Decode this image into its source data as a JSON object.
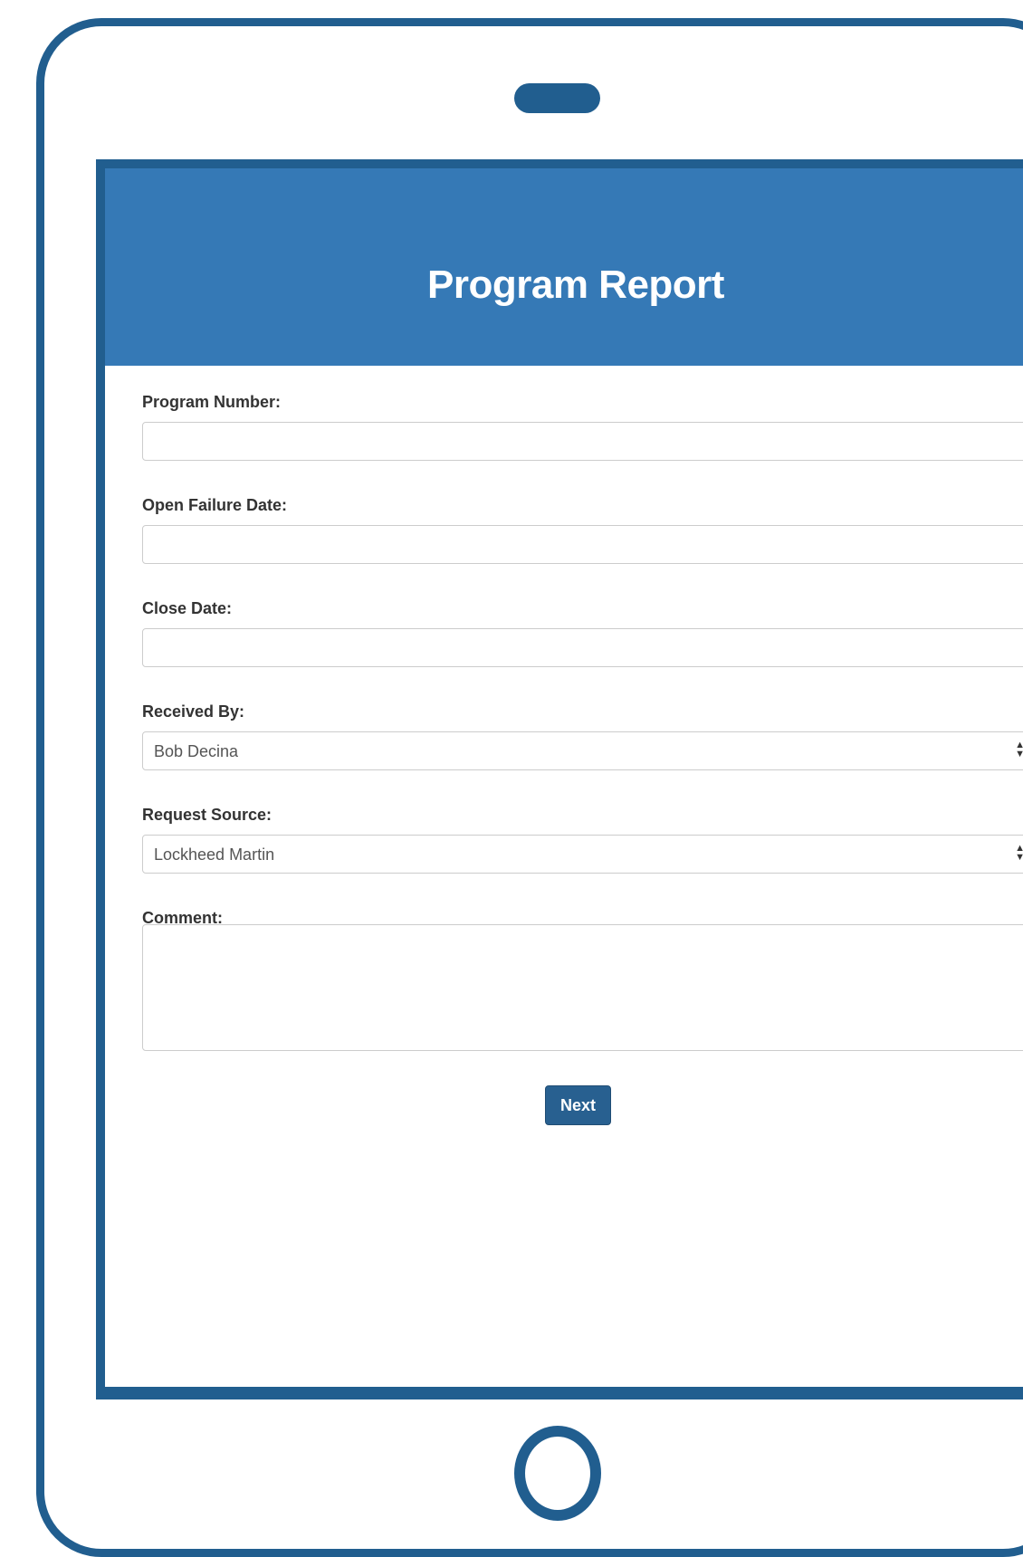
{
  "form": {
    "title": "Program Report",
    "fields": {
      "program_number": {
        "label": "Program Number:",
        "value": ""
      },
      "open_failure_date": {
        "label": "Open Failure Date:",
        "value": ""
      },
      "close_date": {
        "label": "Close Date:",
        "value": ""
      },
      "received_by": {
        "label": "Received By:",
        "selected": "Bob Decina"
      },
      "request_source": {
        "label": "Request Source:",
        "selected": "Lockheed Martin"
      },
      "comment": {
        "label": "Comment:",
        "value": ""
      }
    },
    "next_label": "Next"
  },
  "colors": {
    "frame": "#215e8f",
    "header": "#3579b6",
    "button": "#286090"
  },
  "icons": {
    "select_arrows": "sort-arrows-icon",
    "resize": "resize-grip-icon"
  }
}
